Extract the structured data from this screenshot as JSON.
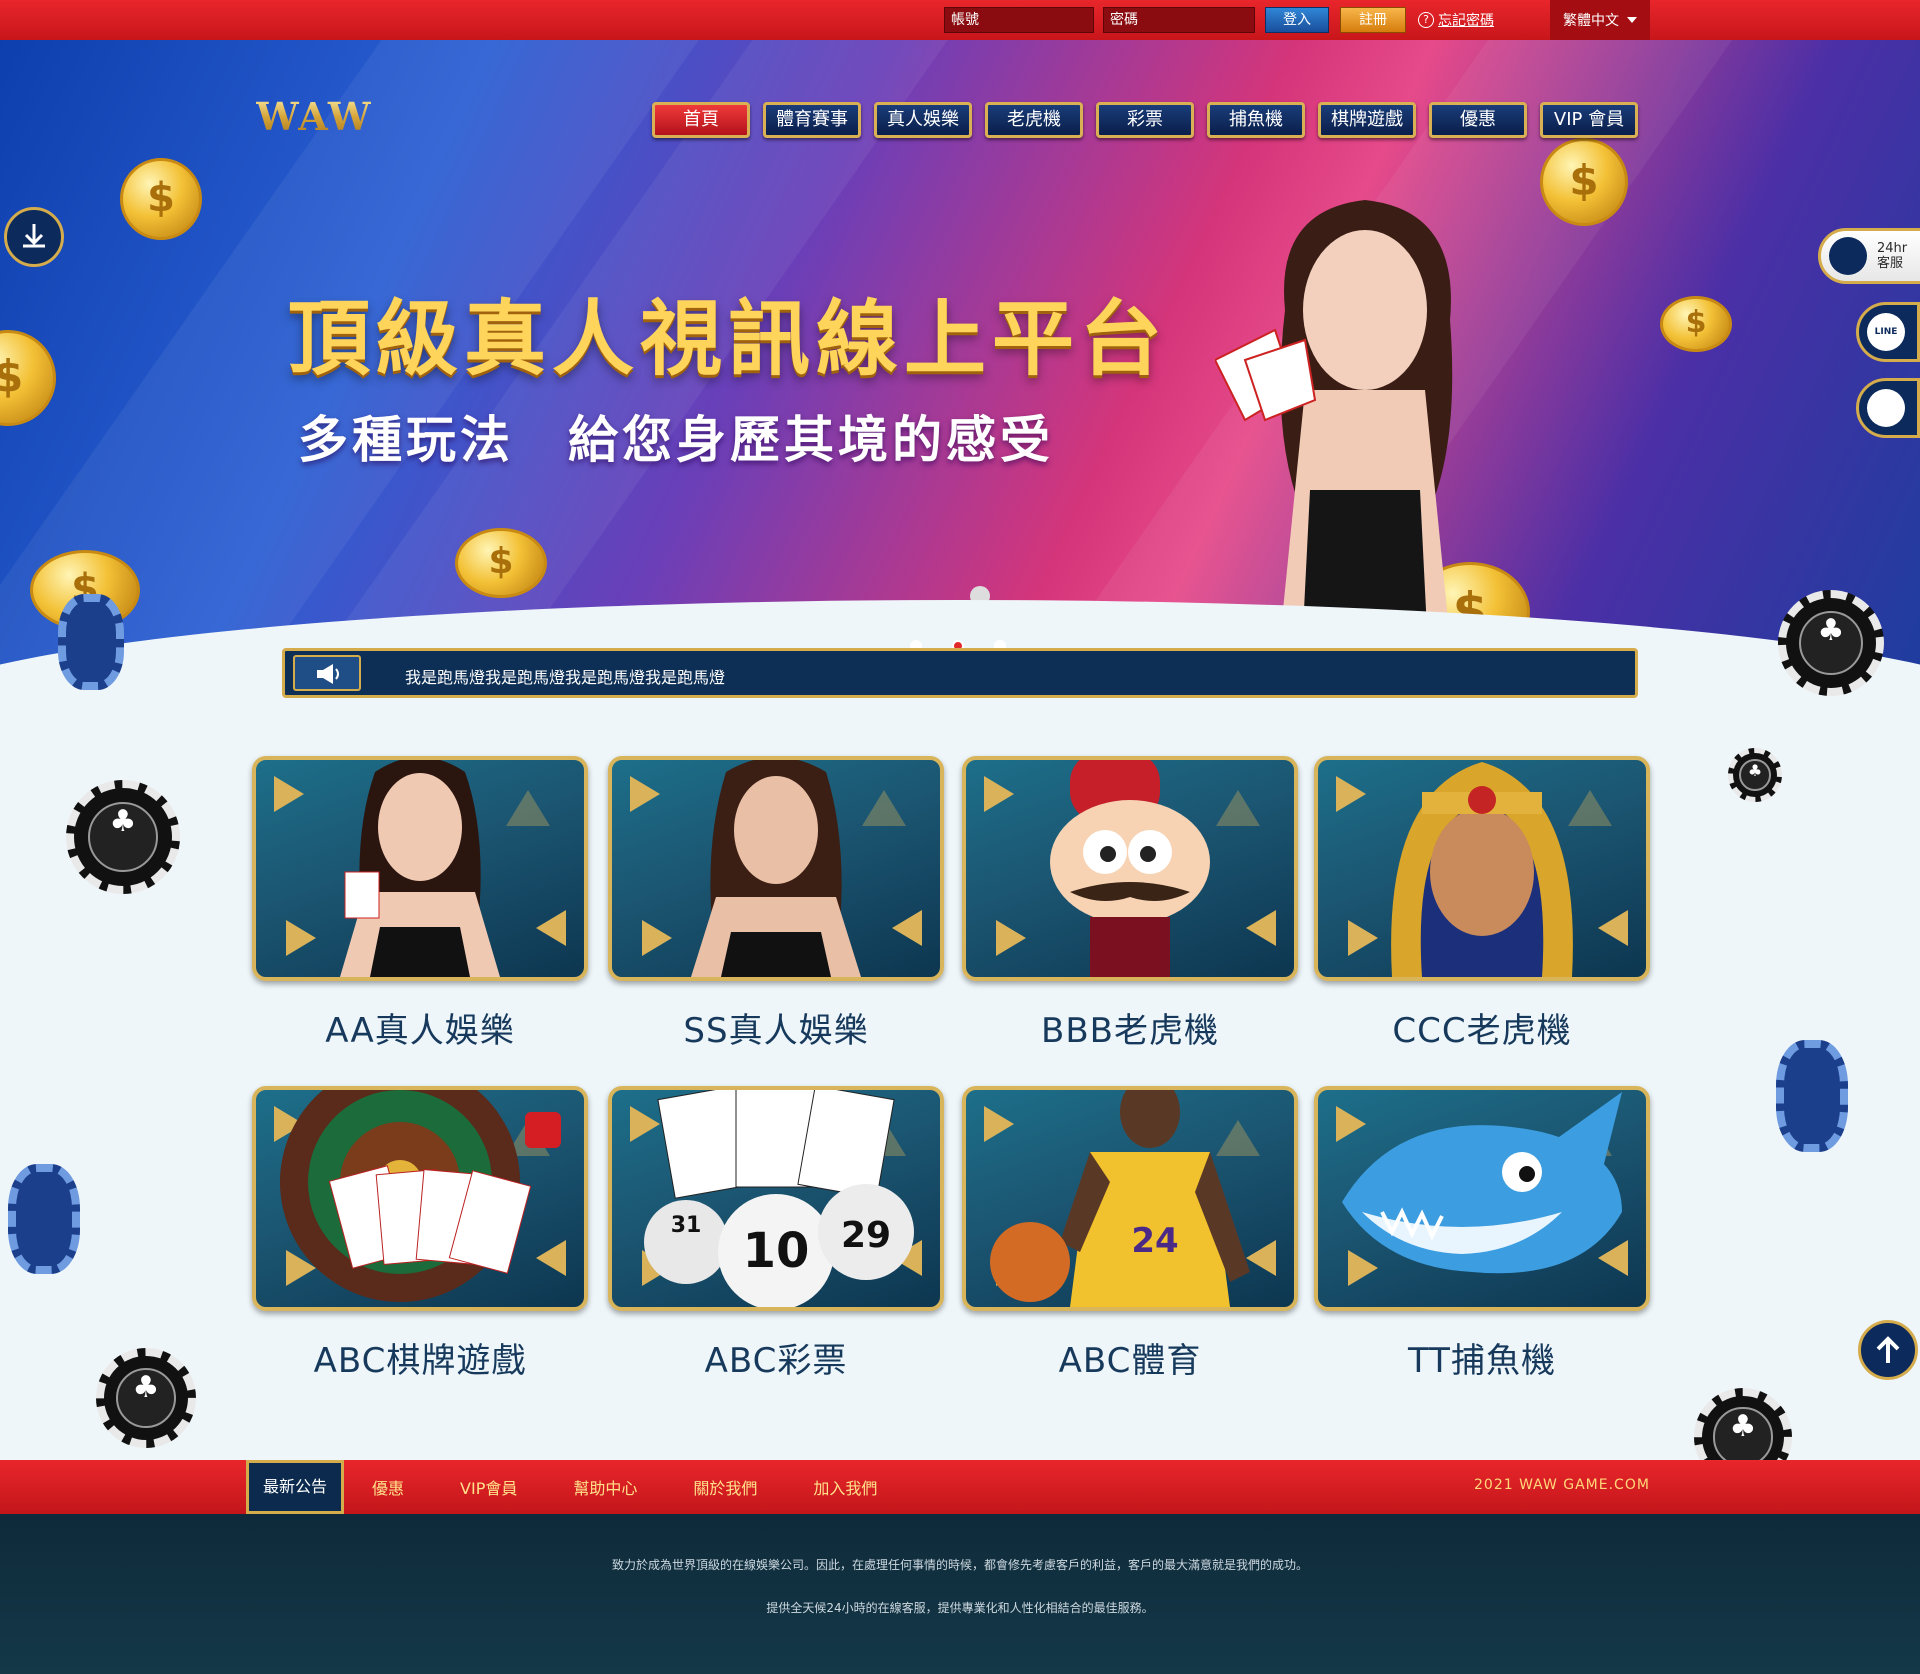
{
  "topbar": {
    "account_placeholder": "帳號",
    "password_placeholder": "密碼",
    "login_label": "登入",
    "register_label": "註冊",
    "forgot_label": "忘記密碼",
    "language": "繁體中文"
  },
  "header": {
    "logo": "WAW",
    "nav": [
      {
        "label": "首頁",
        "active": true
      },
      {
        "label": "體育賽事"
      },
      {
        "label": "真人娛樂"
      },
      {
        "label": "老虎機"
      },
      {
        "label": "彩票"
      },
      {
        "label": "捕魚機"
      },
      {
        "label": "棋牌遊戲"
      },
      {
        "label": "優惠"
      },
      {
        "label": "VIP 會員"
      }
    ]
  },
  "banner": {
    "title": "頂級真人視訊線上平台",
    "subtitle": "多種玩法　給您身歷其境的感受",
    "slides": 3,
    "active_slide": 2
  },
  "marquee": {
    "text": "我是跑馬燈我是跑馬燈我是跑馬燈我是跑馬燈"
  },
  "side": {
    "cs_line1": "24hr",
    "cs_line2": "客服",
    "line_label": "LINE"
  },
  "games": [
    {
      "label": "AA真人娛樂"
    },
    {
      "label": "SS真人娛樂"
    },
    {
      "label": "BBB老虎機"
    },
    {
      "label": "CCC老虎機"
    },
    {
      "label": "ABC棋牌遊戲"
    },
    {
      "label": "ABC彩票"
    },
    {
      "label": "ABC體育"
    },
    {
      "label": "TT捕魚機"
    }
  ],
  "footer_nav": [
    {
      "label": "最新公告",
      "active": true
    },
    {
      "label": "優惠"
    },
    {
      "label": "VIP會員"
    },
    {
      "label": "幫助中心"
    },
    {
      "label": "關於我們"
    },
    {
      "label": "加入我們"
    }
  ],
  "copyright": "2021 WAW GAME.COM",
  "footer_text": {
    "line1": "致力於成為世界頂級的在線娛樂公司。因此，在處理任何事情的時候，都會修先考慮客戶的利益，客戶的最大滿意就是我們的成功。",
    "line2": "提供全天候24小時的在線客服，提供專業化和人性化相結合的最佳服務。"
  },
  "colors": {
    "primary_red": "#e3262b",
    "gold": "#d8b45a",
    "navy": "#0c2a5c",
    "teal": "#1b5571"
  }
}
